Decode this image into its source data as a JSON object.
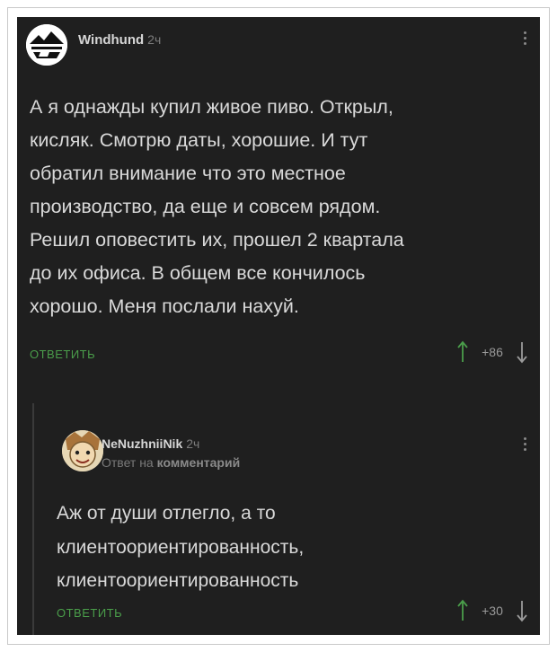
{
  "comments": [
    {
      "username": "Windhund",
      "time": "2ч",
      "text": "А я однажды купил живое пиво. Открыл,\nкисляк. Смотрю даты, хорошие. И тут\nобратил внимание что это местное\nпроизводство, да еще и совсем рядом.\nРешил оповестить их, прошел 2 квартала\nдо их офиса. В общем все кончилось\nхорошо. Меня послали нахуй.",
      "reply_label": "ОТВЕТИТЬ",
      "score": "+86",
      "avatar_icon": "mountain-logo-avatar"
    },
    {
      "username": "NeNuzhniiNik",
      "time": "2ч",
      "reply_to_prefix": "Ответ на",
      "reply_to_target": "комментарий",
      "text": "Аж от души отлегло, а то\nклиентоориентированность,\nклиентоориентированность",
      "reply_label": "ОТВЕТИТЬ",
      "score": "+30",
      "avatar_icon": "cartoon-face-avatar"
    }
  ],
  "colors": {
    "background": "#1f1f1f",
    "text": "#d9d9d9",
    "accent_green": "#4a9d4a",
    "muted": "#7c7c7c"
  }
}
